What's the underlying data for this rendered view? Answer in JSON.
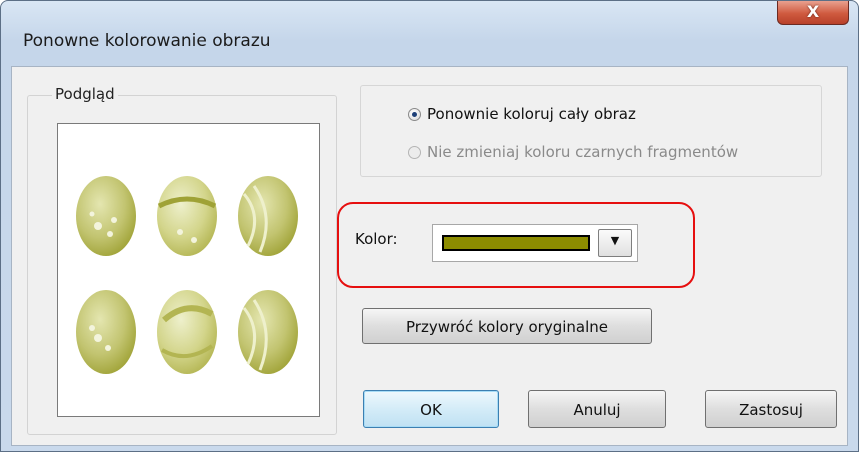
{
  "window": {
    "title": "Ponowne kolorowanie obrazu",
    "close_symbol": "X"
  },
  "preview": {
    "legend": "Podgląd"
  },
  "recolor_options": [
    {
      "label": "Ponownie koloruj cały obraz",
      "checked": true,
      "enabled": true
    },
    {
      "label": "Nie zmieniaj koloru czarnych fragmentów",
      "checked": false,
      "enabled": false
    }
  ],
  "color": {
    "label": "Kolor:",
    "selected_color": "#8c8c00",
    "dropdown_icon": "chevron-down-icon",
    "dropdown_symbol": "▼"
  },
  "buttons": {
    "restore": "Przywróć kolory oryginalne",
    "ok": "OK",
    "cancel": "Anuluj",
    "apply": "Zastosuj"
  },
  "colors": {
    "highlight": "#e60f0f",
    "egg_dark": "#a9ac3c",
    "egg_light": "#d3d58b",
    "close_button": "#cf5a3f"
  }
}
